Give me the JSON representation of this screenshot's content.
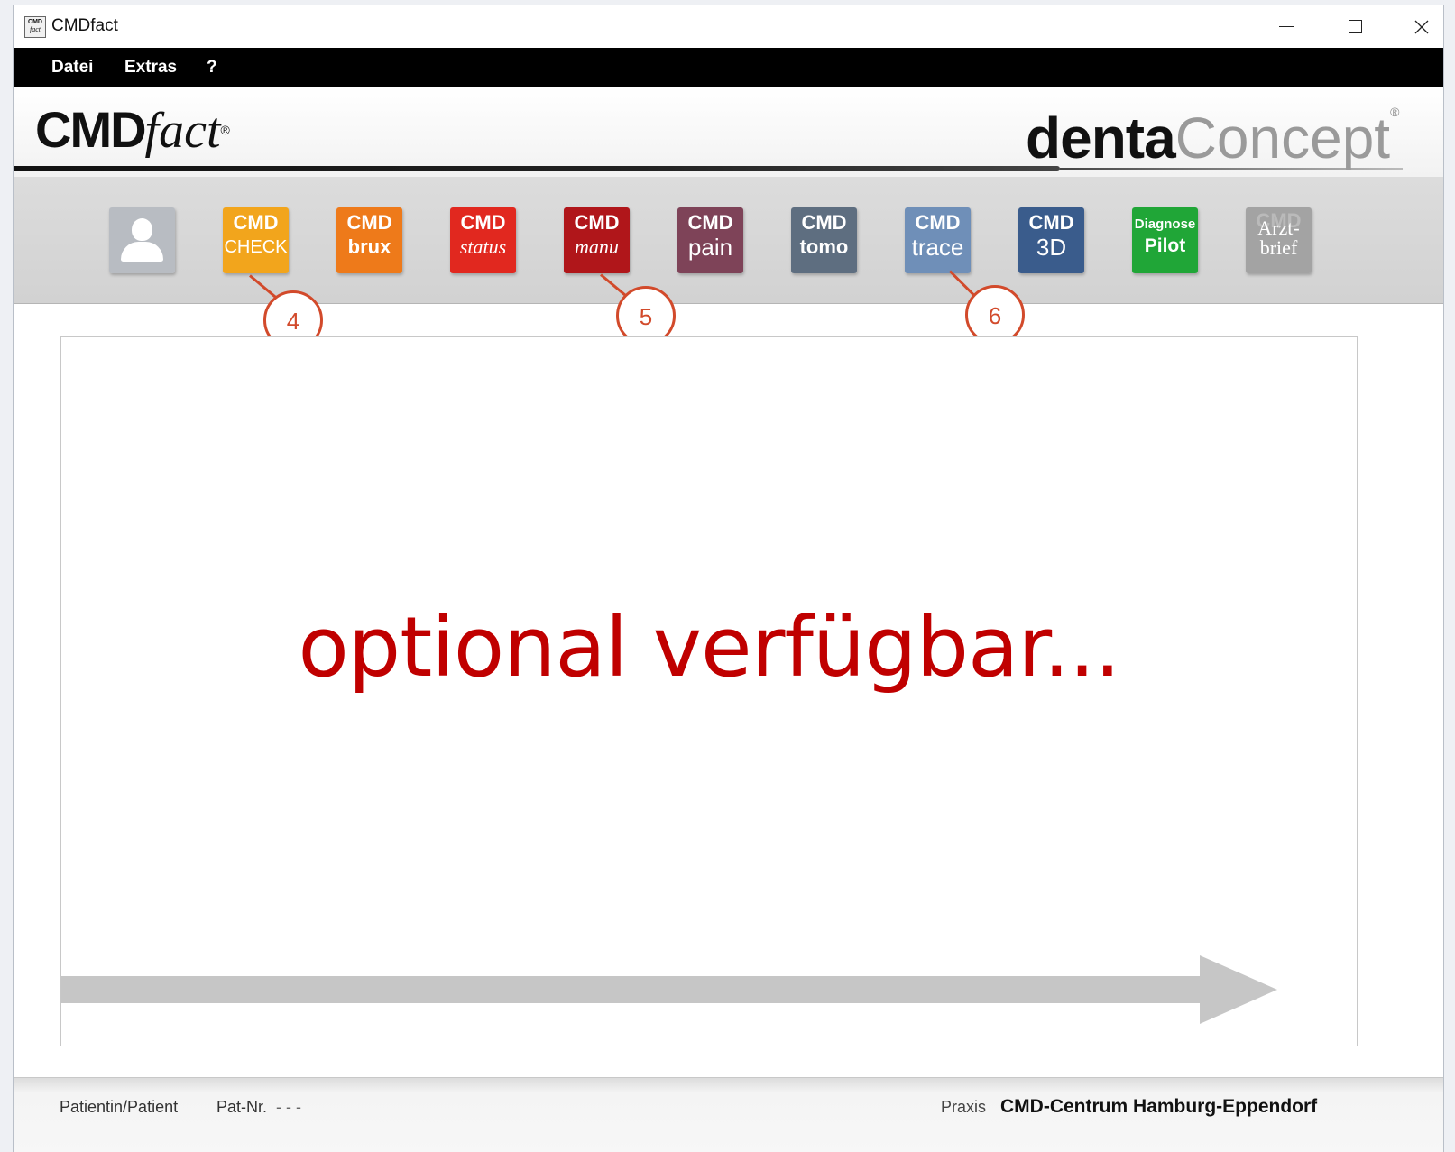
{
  "window": {
    "title": "CMDfact",
    "icon_top": "CMD",
    "icon_bottom": "fact",
    "controls": [
      "minimize-icon",
      "maximize-icon",
      "close-icon"
    ]
  },
  "menu": {
    "items": [
      "Datei",
      "Extras",
      "?"
    ]
  },
  "header": {
    "logo_left_bold": "CMD",
    "logo_left_script": "fact",
    "logo_left_mark": "®",
    "logo_right_bold": "denta",
    "logo_right_light": "Concept",
    "logo_right_mark": "®"
  },
  "toolbar": {
    "tools": [
      {
        "name": "patient",
        "icon": "user-avatar-icon",
        "color": "#b8bcc2"
      },
      {
        "top": "CMD",
        "bottom": "CHECK",
        "color": "#f2a51c"
      },
      {
        "top": "CMD",
        "bottom": "brux",
        "color": "#ee7a1a"
      },
      {
        "top": "CMD",
        "bottom": "status",
        "color": "#e1281f"
      },
      {
        "top": "CMD",
        "bottom": "manu",
        "color": "#b0161a"
      },
      {
        "top": "CMD",
        "bottom": "pain",
        "color": "#7e4358"
      },
      {
        "top": "CMD",
        "bottom": "tomo",
        "color": "#5e6e80"
      },
      {
        "top": "CMD",
        "bottom": "trace",
        "color": "#6f8fb8"
      },
      {
        "top": "CMD",
        "bottom": "3D",
        "color": "#3a5c8c"
      },
      {
        "top": "Diagnose",
        "bottom": "Pilot",
        "color": "#20a637"
      },
      {
        "top": "Arzt-",
        "bottom": "brief",
        "ghost": "CMD",
        "color": "#a3a3a3"
      }
    ]
  },
  "callouts": [
    "4",
    "5",
    "6"
  ],
  "content": {
    "message": "optional verfügbar..."
  },
  "status": {
    "patient_label": "Patientin/Patient",
    "patnr_label": "Pat-Nr.",
    "patnr_value": "- - -",
    "praxis_label": "Praxis",
    "praxis_value": "CMD-Centrum Hamburg-Eppendorf"
  }
}
